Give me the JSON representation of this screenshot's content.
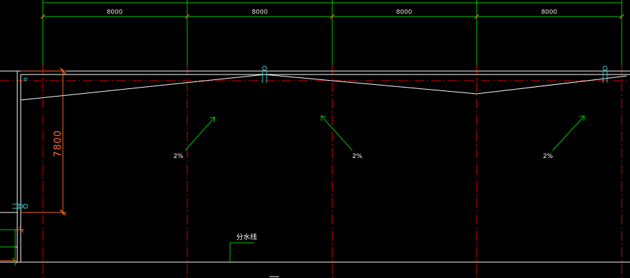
{
  "colors": {
    "background": "#000000",
    "dimension_lines": "#00c800",
    "axis_lines": "#e00000",
    "outline": "#ffffff",
    "vertical_dimension": "#ff6a2a",
    "drain_symbol": "#33cccc"
  },
  "top_dimensions": [
    "8000",
    "8000",
    "8000",
    "8000"
  ],
  "vertical_dimension": "7800",
  "slope_labels": [
    "2%",
    "2%",
    "2%"
  ],
  "ridge_label": "分水线"
}
